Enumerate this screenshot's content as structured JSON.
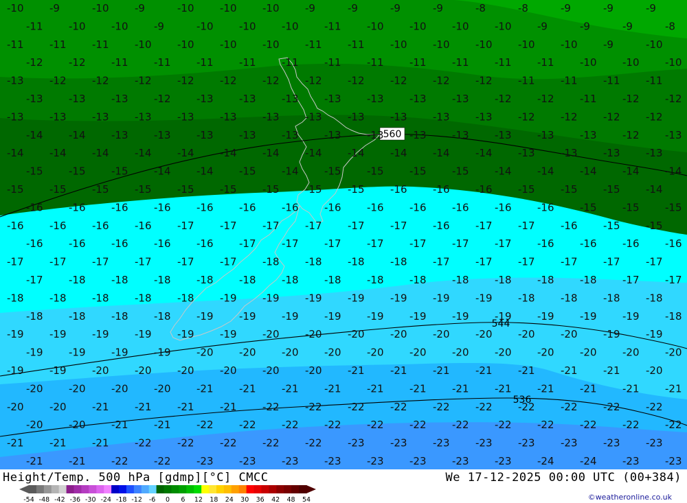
{
  "footer": {
    "title": "Height/Temp. 500 hPa [gdmp][°C] CMCC",
    "datetime": "We 17-12-2025 00:00 UTC (00+384)",
    "credit": "©weatheronline.co.uk"
  },
  "colors": {
    "band_minus_8": "#00a800",
    "band_minus_10": "#009000",
    "band_minus_12": "#007a00",
    "band_minus_14": "#006800",
    "band_minus_16": "#00ffff",
    "band_minus_18": "#30d8ff",
    "band_minus_20": "#22b8ff",
    "band_minus_22": "#3a98ff",
    "coastline": "#c8c8c8",
    "contour": "#000000"
  },
  "color_scale": {
    "labels": [
      "-54",
      "-48",
      "-42",
      "-36",
      "-30",
      "-24",
      "-18",
      "-12",
      "-6",
      "0",
      "6",
      "12",
      "18",
      "24",
      "30",
      "36",
      "42",
      "48",
      "54"
    ],
    "colors": [
      "#5a5a5a",
      "#787878",
      "#969696",
      "#b4b4b4",
      "#d2d2d2",
      "#8c1e8c",
      "#a02ca8",
      "#b43cc0",
      "#c850d8",
      "#dc64ee",
      "#f080ff",
      "#0000c8",
      "#0010e8",
      "#1e50ff",
      "#3c82ff",
      "#50aaff",
      "#64d2ff",
      "#006400",
      "#007800",
      "#008c00",
      "#00a000",
      "#00be00",
      "#00dc00",
      "#ffff00",
      "#ffe632",
      "#ffd200",
      "#ffbe00",
      "#ffa000",
      "#ff8200",
      "#ff0000",
      "#e60000",
      "#c80000",
      "#aa0000",
      "#8c0000",
      "#780000",
      "#640000",
      "#500000"
    ]
  },
  "contours": [
    {
      "value": "560",
      "label_text": "560"
    },
    {
      "value": "544",
      "label_text": "544"
    },
    {
      "value": "536",
      "label_text": "536"
    }
  ],
  "temp_rows": [
    [
      "-10",
      "-9",
      "-10",
      "-9",
      "-10",
      "-10",
      "-10",
      "-9",
      "-9",
      "-9",
      "-9",
      "-8",
      "-8",
      "-9",
      "-9",
      "-9"
    ],
    [
      "-11",
      "-10",
      "-10",
      "-9",
      "-10",
      "-10",
      "-10",
      "-11",
      "-10",
      "-10",
      "-10",
      "-10",
      "-9",
      "-9",
      "-9",
      "-8"
    ],
    [
      "-11",
      "-11",
      "-11",
      "-10",
      "-10",
      "-10",
      "-10",
      "-11",
      "-11",
      "-10",
      "-10",
      "-10",
      "-10",
      "-10",
      "-9",
      "-10"
    ],
    [
      "-12",
      "-12",
      "-11",
      "-11",
      "-11",
      "-11",
      "-11",
      "-11",
      "-11",
      "-11",
      "-11",
      "-11",
      "-11",
      "-10",
      "-10",
      "-10"
    ],
    [
      "-13",
      "-12",
      "-12",
      "-12",
      "-12",
      "-12",
      "-12",
      "-12",
      "-12",
      "-12",
      "-12",
      "-12",
      "-11",
      "-11",
      "-11",
      "-11"
    ],
    [
      "-13",
      "-13",
      "-13",
      "-12",
      "-13",
      "-13",
      "-13",
      "-13",
      "-13",
      "-13",
      "-13",
      "-12",
      "-12",
      "-11",
      "-12",
      "-12"
    ],
    [
      "-13",
      "-13",
      "-13",
      "-13",
      "-13",
      "-13",
      "-13",
      "-13",
      "-13",
      "-13",
      "-13",
      "-13",
      "-12",
      "-12",
      "-12",
      "-12"
    ],
    [
      "-14",
      "-14",
      "-13",
      "-13",
      "-13",
      "-13",
      "-13",
      "-13",
      "-13",
      "-13",
      "-13",
      "-13",
      "-13",
      "-13",
      "-12",
      "-13"
    ],
    [
      "-14",
      "-14",
      "-14",
      "-14",
      "-14",
      "-14",
      "-14",
      "-14",
      "-14",
      "-14",
      "-14",
      "-14",
      "-13",
      "-13",
      "-13",
      "-13"
    ],
    [
      "-15",
      "-15",
      "-15",
      "-14",
      "-14",
      "-15",
      "-14",
      "-15",
      "-15",
      "-15",
      "-15",
      "-14",
      "-14",
      "-14",
      "-14",
      "-14"
    ],
    [
      "-15",
      "-15",
      "-15",
      "-15",
      "-15",
      "-15",
      "-15",
      "-15",
      "-15",
      "-16",
      "-16",
      "-16",
      "-15",
      "-15",
      "-15",
      "-14"
    ],
    [
      "-16",
      "-16",
      "-16",
      "-16",
      "-16",
      "-16",
      "-16",
      "-16",
      "-16",
      "-16",
      "-16",
      "-16",
      "-16",
      "-15",
      "-15",
      "-15"
    ],
    [
      "-16",
      "-16",
      "-16",
      "-16",
      "-17",
      "-17",
      "-17",
      "-17",
      "-17",
      "-17",
      "-16",
      "-17",
      "-17",
      "-16",
      "-15",
      "-15"
    ],
    [
      "-16",
      "-16",
      "-16",
      "-16",
      "-16",
      "-17",
      "-17",
      "-17",
      "-17",
      "-17",
      "-17",
      "-17",
      "-16",
      "-16",
      "-16",
      "-16"
    ],
    [
      "-17",
      "-17",
      "-17",
      "-17",
      "-17",
      "-17",
      "-18",
      "-18",
      "-18",
      "-18",
      "-17",
      "-17",
      "-17",
      "-17",
      "-17",
      "-17"
    ],
    [
      "-17",
      "-18",
      "-18",
      "-18",
      "-18",
      "-18",
      "-18",
      "-18",
      "-18",
      "-18",
      "-18",
      "-18",
      "-18",
      "-18",
      "-17",
      "-17"
    ],
    [
      "-18",
      "-18",
      "-18",
      "-18",
      "-18",
      "-19",
      "-19",
      "-19",
      "-19",
      "-19",
      "-19",
      "-19",
      "-18",
      "-18",
      "-18",
      "-18"
    ],
    [
      "-18",
      "-18",
      "-18",
      "-18",
      "-19",
      "-19",
      "-19",
      "-19",
      "-19",
      "-19",
      "-19",
      "-19",
      "-19",
      "-19",
      "-19",
      "-18"
    ],
    [
      "-19",
      "-19",
      "-19",
      "-19",
      "-19",
      "-19",
      "-20",
      "-20",
      "-20",
      "-20",
      "-20",
      "-20",
      "-20",
      "-20",
      "-19",
      "-19"
    ],
    [
      "-19",
      "-19",
      "-19",
      "-19",
      "-20",
      "-20",
      "-20",
      "-20",
      "-20",
      "-20",
      "-20",
      "-20",
      "-20",
      "-20",
      "-20",
      "-20"
    ],
    [
      "-19",
      "-19",
      "-20",
      "-20",
      "-20",
      "-20",
      "-20",
      "-20",
      "-21",
      "-21",
      "-21",
      "-21",
      "-21",
      "-21",
      "-21",
      "-20"
    ],
    [
      "-20",
      "-20",
      "-20",
      "-20",
      "-21",
      "-21",
      "-21",
      "-21",
      "-21",
      "-21",
      "-21",
      "-21",
      "-21",
      "-21",
      "-21",
      "-21"
    ],
    [
      "-20",
      "-20",
      "-21",
      "-21",
      "-21",
      "-21",
      "-22",
      "-22",
      "-22",
      "-22",
      "-22",
      "-22",
      "-22",
      "-22",
      "-22",
      "-22"
    ],
    [
      "-20",
      "-20",
      "-21",
      "-21",
      "-22",
      "-22",
      "-22",
      "-22",
      "-22",
      "-22",
      "-22",
      "-22",
      "-22",
      "-22",
      "-22",
      "-22"
    ],
    [
      "-21",
      "-21",
      "-21",
      "-22",
      "-22",
      "-22",
      "-22",
      "-22",
      "-23",
      "-23",
      "-23",
      "-23",
      "-23",
      "-23",
      "-23",
      "-23"
    ],
    [
      "-21",
      "-21",
      "-22",
      "-22",
      "-23",
      "-23",
      "-23",
      "-23",
      "-23",
      "-23",
      "-23",
      "-23",
      "-24",
      "-24",
      "-23",
      "-23"
    ]
  ]
}
